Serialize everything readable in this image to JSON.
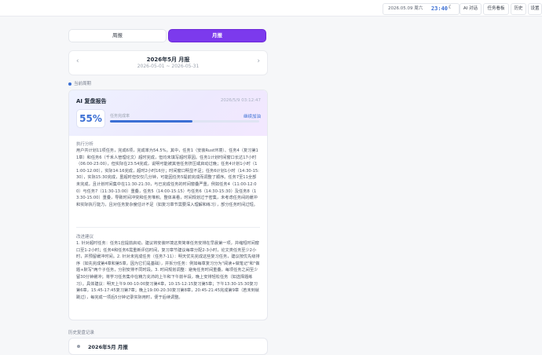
{
  "topbar": {
    "date": "2026.05.09 周六",
    "time": "23:40",
    "theme_icon": "moon-icon",
    "buttons": [
      "AI 对话",
      "任务看板",
      "历史",
      "设置"
    ]
  },
  "tabs": {
    "week": "周报",
    "month": "月报",
    "active": "month"
  },
  "period": {
    "title": "2026年5月 月报",
    "range": "2026-05-01 ~ 2026-05-31",
    "prev_icon": "chevron-left-icon",
    "next_icon": "chevron-right-icon"
  },
  "current_label": "当前周期",
  "report": {
    "title": "AI 复盘报告",
    "timestamp": "2026/5/9 03:12:47",
    "percent": "55%",
    "progress_label": "任务完成率",
    "progress_value": 0.55,
    "status": "继续加油",
    "analysis_title": "执行分析",
    "analysis_text": "用户共计划11项任务，完成6项，完成率为54.5%。其中，任务1（安装Rust环境）、任务4（复习第11章）和任务6（千禾人管理论文）超时完成，但均未填写超时原因。任务1计划时间窗口长达17小时（06:00-23:00），但实际在23:54完成，说明可能被其他任务挤压或启动过晚；任务4计划1小时（11:00-12:00），实际14:16完成，超时2小时16分；时间窗口明显不足；任务6计划1小时（14:30-15:30），实际15:30完成，虽超时但仅仅几分钟，可能因任务5提前完成而调整了顺序。任务7至11全部未完成，且计划时间集中在11:30-21:30，与已完成任务的时间窗叠严重。例如任务4（11:00-12:00）与任务7（11:30-13:00）重叠，任务5（14:00-15:15）与任务6（14:30-15:30）及任务8（13:30-15:00）重叠，导致时间冲突和任务堆积。整体来看，时间规划过于密集，未考虑任务间的缓冲和实际执行能力，且对任务复杂度估计不足（如复习章节需要深入理解和练习），部分任务时间过短。",
    "suggestion_title": "改进建议",
    "suggestion_text": "1. 针对超时任务：任务1应提前启动，建议将安装环境这类简单任务安排在早晨第一项，并缩短时间窗口至1-2小时；任务4和任务6需重新评估时间，复习章节建议每章分配2-3小时，论文类任务至少2小时，并预留缓冲时间。2. 针对未完成任务（任务7-11）：明天优先完成这些复习任务，建议按优先级排序（如先完成第4章和第5章，因为它们是基础），并拆分任务：例如每章复习分为\"阅读+做笔记\"和\"做题+默写\"两个子任务，分别安排不同时段。3. 时间规划调整：避免任务时间重叠，每项任务之间至少留30分钟缓冲；将学习任务集中在精力充沛的上午和下午前半段，晚上安排轻松任务（如选择题练习）。具体建议：明天上午9:00-10:00复习第4章，10:15-12:15复习第5章；下午13:30-15:30复习第6章，15:45-17:45复习第7章；晚上19:00-20:30复习第8章，20:45-21:45完成第9章（若未到就跳过），每完成一项后5分钟记录实际用时，便于后续调整。"
  },
  "history": {
    "label": "历史复盘记录",
    "items": [
      {
        "title": "2026年5月 月报"
      }
    ]
  }
}
